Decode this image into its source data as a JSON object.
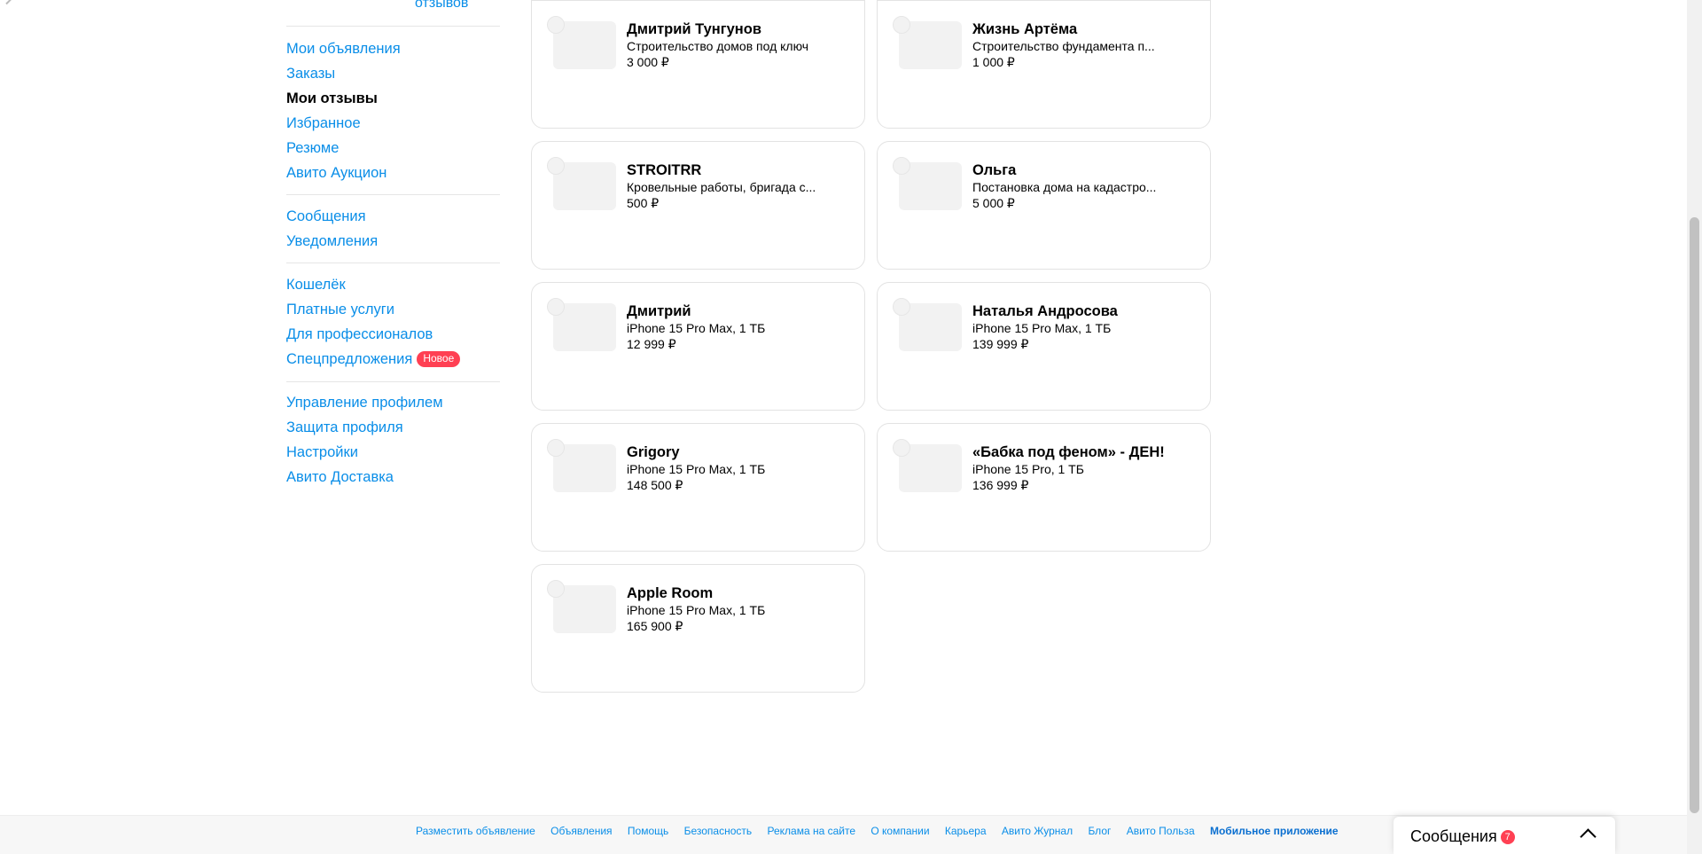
{
  "sidebar": {
    "top_link": "отзывов",
    "groups": [
      [
        "Мои объявления",
        "Заказы",
        "Мои отзывы",
        "Избранное",
        "Резюме",
        "Авито Аукцион"
      ],
      [
        "Сообщения",
        "Уведомления"
      ],
      [
        "Кошелёк",
        "Платные услуги",
        "Для профессионалов",
        "Спецпредложения"
      ],
      [
        "Управление профилем",
        "Защита профиля",
        "Настройки",
        "Авито Доставка"
      ]
    ],
    "items": {
      "my_ads": "Мои объявления",
      "orders": "Заказы",
      "my_reviews": "Мои отзывы",
      "favorites": "Избранное",
      "resume": "Резюме",
      "auction": "Авито Аукцион",
      "messages": "Сообщения",
      "notifications": "Уведомления",
      "wallet": "Кошелёк",
      "paid_services": "Платные услуги",
      "for_pros": "Для профессионалов",
      "special_offers": "Спецпредложения",
      "special_offers_badge": "Новое",
      "profile_manage": "Управление профилем",
      "profile_protect": "Защита профиля",
      "settings": "Настройки",
      "delivery": "Авито Доставка"
    }
  },
  "cards": [
    {
      "name": "Дмитрий Тунгунов",
      "desc": "Строительство домов под ключ",
      "price": "3 000 ₽"
    },
    {
      "name": "Жизнь Артёма",
      "desc": "Строительство фундамента п...",
      "price": "1 000 ₽"
    },
    {
      "name": "STROITRR",
      "desc": "Кровельные работы, бригада с...",
      "price": "500 ₽"
    },
    {
      "name": "Ольга",
      "desc": "Постановка дома на кадастро...",
      "price": "5 000 ₽"
    },
    {
      "name": "Дмитрий",
      "desc": "iPhone 15 Pro Max, 1 ТБ",
      "price": "12 999 ₽"
    },
    {
      "name": "Наталья Андросова",
      "desc": "iPhone 15 Pro Max, 1 ТБ",
      "price": "139 999 ₽"
    },
    {
      "name": "Grigory",
      "desc": "iPhone 15 Pro Max, 1 ТБ",
      "price": "148 500 ₽"
    },
    {
      "name": "«Бабка под феном» - ДЕН!",
      "desc": "iPhone 15 Pro, 1 ТБ",
      "price": "136 999 ₽"
    },
    {
      "name": "Apple Room",
      "desc": "iPhone 15 Pro Max, 1 ТБ",
      "price": "165 900 ₽"
    }
  ],
  "footer": {
    "links": [
      "Разместить объявление",
      "Объявления",
      "Помощь",
      "Безопасность",
      "Реклама на сайте",
      "О компании",
      "Карьера",
      "Авито Журнал",
      "Блог",
      "Авито Польза",
      "Мобильное приложение"
    ]
  },
  "messenger": {
    "title": "Сообщения",
    "count": "7"
  },
  "colors": {
    "link": "#0a8ee8",
    "badge": "#ff4053",
    "card_border": "#e3e3e3",
    "placeholder": "#f2f2f2"
  }
}
